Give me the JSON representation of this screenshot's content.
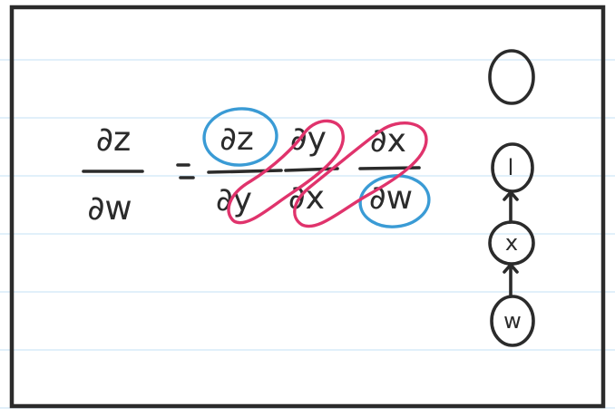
{
  "equation": {
    "lhs_numerator": "∂z",
    "lhs_denominator": "∂w",
    "equals": "=",
    "terms": [
      {
        "numerator": "∂z",
        "denominator": "∂y"
      },
      {
        "numerator": "∂y",
        "denominator": "∂x"
      },
      {
        "numerator": "∂x",
        "denominator": "∂w"
      }
    ]
  },
  "graph": {
    "nodes": [
      "",
      "l",
      "x",
      "w"
    ]
  },
  "colors": {
    "ink": "#2b2b2b",
    "circle_highlight": "#3a9bd5",
    "cancel_highlight": "#e0336c",
    "ruled_lines": "#cfe6f7"
  }
}
